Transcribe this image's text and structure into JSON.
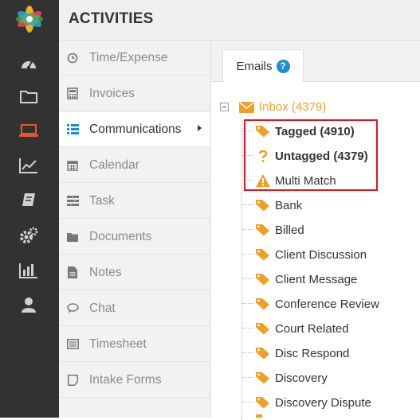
{
  "header": {
    "title": "ACTIVITIES"
  },
  "rail": {
    "icons": [
      "dashboard-icon",
      "folder-icon",
      "laptop-icon",
      "line-chart-icon",
      "book-icon",
      "gears-icon",
      "bar-chart-icon",
      "user-icon"
    ],
    "active_color": "#e8562b"
  },
  "menu": {
    "items": [
      {
        "label": "Time/Expense",
        "icon": "clock-icon"
      },
      {
        "label": "Invoices",
        "icon": "calculator-icon"
      },
      {
        "label": "Communications",
        "icon": "list-icon"
      },
      {
        "label": "Calendar",
        "icon": "calendar-icon"
      },
      {
        "label": "Task",
        "icon": "task-icon"
      },
      {
        "label": "Documents",
        "icon": "folder-icon"
      },
      {
        "label": "Notes",
        "icon": "note-icon"
      },
      {
        "label": "Chat",
        "icon": "chat-icon"
      },
      {
        "label": "Timesheet",
        "icon": "timesheet-icon"
      },
      {
        "label": "Intake Forms",
        "icon": "form-icon"
      }
    ],
    "active": "Communications"
  },
  "tabs": {
    "emails_label": "Emails",
    "help_glyph": "?"
  },
  "tree": {
    "inbox_label": "Inbox (4379)",
    "highlighted": [
      {
        "label": "Tagged (4910)",
        "icon": "tag-icon"
      },
      {
        "label": "Untagged (4379)",
        "icon": "question-icon"
      },
      {
        "label": "Multi Match",
        "icon": "warning-icon"
      }
    ],
    "tags": [
      "Bank",
      "Billed",
      "Client Discussion",
      "Client Message",
      "Conference Review",
      "Court Related",
      "Disc Respond",
      "Discovery",
      "Discovery Dispute"
    ]
  },
  "colors": {
    "accent_orange": "#f0a022",
    "highlight_red": "#e3141f",
    "help_blue": "#1a8fd6"
  }
}
